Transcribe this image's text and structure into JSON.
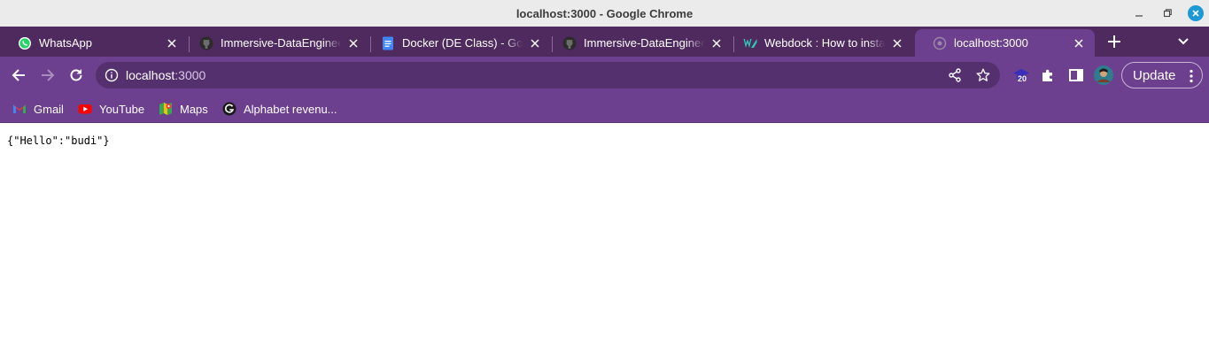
{
  "window": {
    "title": "localhost:3000 - Google Chrome"
  },
  "tabs": [
    {
      "title": "WhatsApp",
      "favicon": "whatsapp-icon",
      "active": false
    },
    {
      "title": "Immersive-DataEngineer",
      "favicon": "github-icon",
      "active": false
    },
    {
      "title": "Docker (DE Class) - Google Docs",
      "favicon": "google-docs-icon",
      "active": false
    },
    {
      "title": "Immersive-DataEngineer",
      "favicon": "github-icon",
      "active": false
    },
    {
      "title": "Webdock : How to install",
      "favicon": "webdock-icon",
      "active": false
    },
    {
      "title": "localhost:3000",
      "favicon": "globe-icon",
      "active": true
    }
  ],
  "toolbar": {
    "url_host": "localhost",
    "url_port": ":3000",
    "extension_badge": "20",
    "update_label": "Update"
  },
  "bookmarks": [
    {
      "label": "Gmail",
      "favicon": "gmail-icon"
    },
    {
      "label": "YouTube",
      "favicon": "youtube-icon"
    },
    {
      "label": "Maps",
      "favicon": "maps-icon"
    },
    {
      "label": "Alphabet revenu...",
      "favicon": "alphabet-icon"
    }
  ],
  "page": {
    "body_text": "{\"Hello\":\"budi\"}"
  },
  "colors": {
    "tabstrip": "#4f2a5e",
    "toolbar": "#6d3f8f",
    "omnibox": "#55306f"
  }
}
